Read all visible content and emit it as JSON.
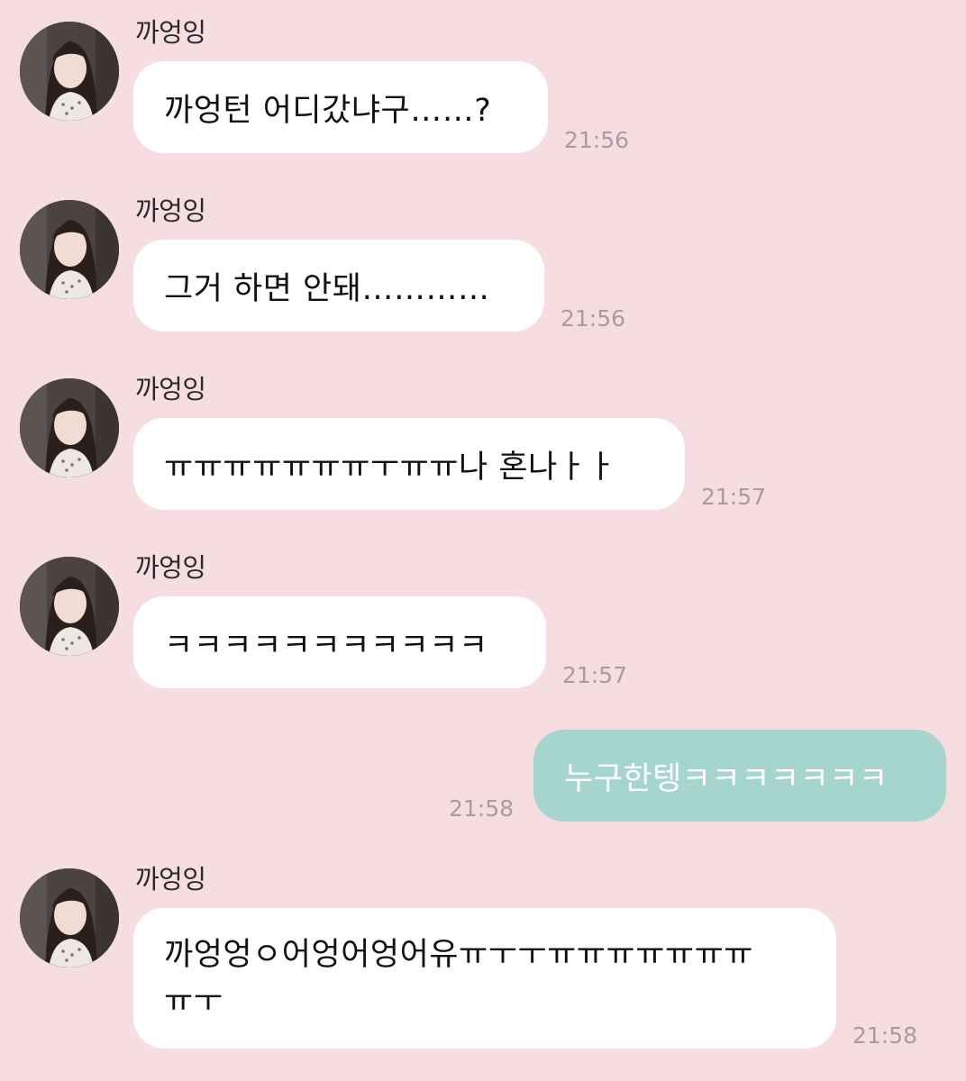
{
  "chat": {
    "sender_name": "까엉잉",
    "messages": [
      {
        "from": "them",
        "text": "까엉턴 어디갔냐구……?",
        "time": "21:56"
      },
      {
        "from": "them",
        "text": "그거 하면 안돼…………",
        "time": "21:56"
      },
      {
        "from": "them",
        "text": "ㅠㅠㅠㅠㅠㅠㅠㅜㅠㅠ나 혼나ㅏㅏ",
        "time": "21:57"
      },
      {
        "from": "them",
        "text": "ㅋㅋㅋㅋㅋㅋㅋㅋㅋㅋㅋ",
        "time": "21:57"
      },
      {
        "from": "me",
        "text": "누구한텡ㅋㅋㅋㅋㅋㅋㅋ",
        "time": "21:58"
      },
      {
        "from": "them",
        "line1": "까엉엉ㅇ어엉어엉어유ㅠㅜㅜㅠㅠㅠㅠㅠㅠㅠ",
        "line2": "ㅠㅜ",
        "time": "21:58"
      }
    ]
  },
  "colors": {
    "background": "#f5dde2",
    "their_bubble": "#ffffff",
    "my_bubble": "#a6d5cd",
    "timestamp": "#a89ca0"
  },
  "icons": {
    "avatar": "profile-photo"
  }
}
